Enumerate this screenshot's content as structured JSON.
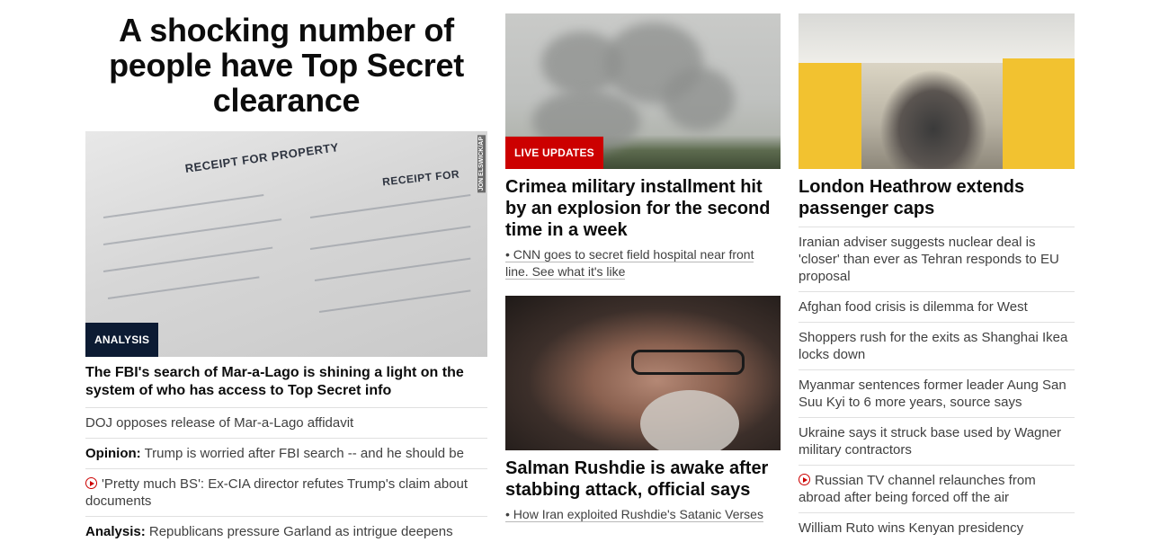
{
  "col1": {
    "headline": "A shocking number of people have Top Secret clearance",
    "image_alt": "FBI receipt for property document",
    "image_credit": "JON ELSWICK/AP",
    "doc_title": "RECEIPT FOR PROPERTY",
    "doc_title_2": "RECEIPT FOR",
    "badge": "ANALYSIS",
    "story_title": "The FBI's search of Mar-a-Lago is shining a light on the system of who has access to Top Secret info",
    "list": [
      {
        "prefix": "",
        "text": "DOJ opposes release of Mar-a-Lago affidavit",
        "video": false
      },
      {
        "prefix": "Opinion:",
        "text": "Trump is worried after FBI search -- and he should be",
        "video": false
      },
      {
        "prefix": "",
        "text": "'Pretty much BS': Ex-CIA director refutes Trump's claim about documents",
        "video": true
      },
      {
        "prefix": "Analysis:",
        "text": "Republicans pressure Garland as intrigue deepens",
        "video": false
      }
    ]
  },
  "col2": {
    "story1": {
      "badge": "LIVE UPDATES",
      "title": "Crimea military installment hit by an explosion for the second time in a week",
      "bullet": "• CNN goes to secret field hospital near front line. See what it's like"
    },
    "story2": {
      "title": "Salman Rushdie is awake after stabbing attack, official says",
      "bullet": "• How Iran exploited Rushdie's Satanic Verses"
    }
  },
  "col3": {
    "title": "London Heathrow extends passenger caps",
    "list": [
      {
        "text": "Iranian adviser suggests nuclear deal is 'closer' than ever as Tehran responds to EU proposal",
        "video": false
      },
      {
        "text": "Afghan food crisis is dilemma for West",
        "video": false
      },
      {
        "text": "Shoppers rush for the exits as Shanghai Ikea locks down",
        "video": false
      },
      {
        "text": "Myanmar sentences former leader Aung San Suu Kyi to 6 more years, source says",
        "video": false
      },
      {
        "text": "Ukraine says it struck base used by Wagner military contractors",
        "video": false
      },
      {
        "text": "Russian TV channel relaunches from abroad after being forced off the air",
        "video": true
      },
      {
        "text": "William Ruto wins Kenyan presidency",
        "video": false
      }
    ]
  },
  "colors": {
    "live_badge": "#cc0000",
    "analysis_badge": "#0c1b33",
    "text": "#0c0c0c",
    "secondary_text": "#404040"
  }
}
